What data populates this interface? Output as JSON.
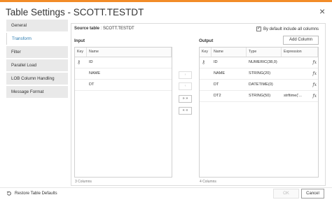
{
  "title": "Table Settings - SCOTT.TESTDT",
  "close_glyph": "×",
  "sidebar": {
    "items": [
      {
        "label": "General"
      },
      {
        "label": "Transform"
      },
      {
        "label": "Filter"
      },
      {
        "label": "Parallel Load"
      },
      {
        "label": "LOB Column Handling"
      },
      {
        "label": "Message Format"
      }
    ],
    "active_index": 1
  },
  "source_table": {
    "label": "Source table",
    "value": "SCOTT.TESTDT"
  },
  "include_all": {
    "label": "By default include all columns",
    "checked": true,
    "check_glyph": "✓"
  },
  "add_column_label": "Add Column",
  "input": {
    "title": "Input",
    "headers": {
      "key": "Key",
      "name": "Name"
    },
    "rows": [
      {
        "key": true,
        "name": "ID"
      },
      {
        "key": false,
        "name": "NAME"
      },
      {
        "key": false,
        "name": "DT"
      }
    ],
    "count_text": "3 Columns"
  },
  "output": {
    "title": "Output",
    "headers": {
      "key": "Key",
      "name": "Name",
      "type": "Type",
      "expression": "Expression"
    },
    "rows": [
      {
        "key": true,
        "name": "ID",
        "type": "NUMERIC(38,0)",
        "expression": ""
      },
      {
        "key": false,
        "name": "NAME",
        "type": "STRING(20)",
        "expression": ""
      },
      {
        "key": false,
        "name": "DT",
        "type": "DATETIME(0)",
        "expression": ""
      },
      {
        "key": false,
        "name": "DT2",
        "type": "STRING(50)",
        "expression": "strftime('..."
      }
    ],
    "count_text": "4 Columns"
  },
  "mid_buttons": {
    "move_right": "›",
    "move_left": "‹",
    "move_all_right": "» »",
    "move_all_left": "« «"
  },
  "fx_glyph": "fx",
  "key_glyph": "⚷",
  "restore_label": "Restore Table Defaults",
  "ok_label": "OK",
  "cancel_label": "Cancel",
  "colors": {
    "accent": "#f28c28",
    "link": "#2a7ab0"
  }
}
